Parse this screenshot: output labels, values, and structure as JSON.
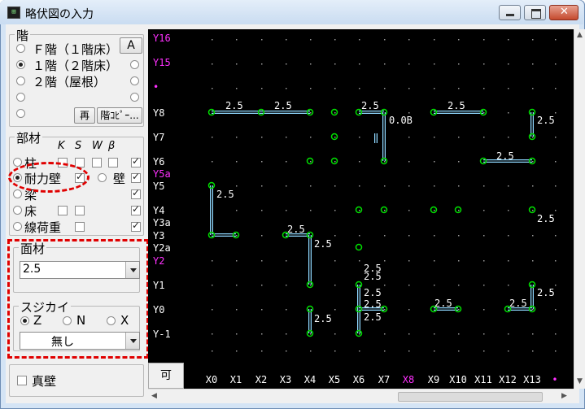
{
  "window": {
    "title": "略伏図の入力",
    "app_icon": "grid-app-icon"
  },
  "floor": {
    "title": "階",
    "a_button": "A",
    "options": [
      "Ｆ階（１階床）",
      "１階（２階床）",
      "２階（屋根）"
    ],
    "selected": 1,
    "btn_re": "再",
    "btn_copy": "階ｺﾋﾟｰ..."
  },
  "members": {
    "title": "部材",
    "headers": [
      "K",
      "S",
      "W",
      "β"
    ],
    "items": [
      {
        "label": "柱",
        "selected": false
      },
      {
        "label": "耐力壁",
        "selected": true
      },
      {
        "label": "梁",
        "selected": false
      },
      {
        "label": "床",
        "selected": false
      },
      {
        "label": "線荷重",
        "selected": false
      }
    ],
    "wall_label": "壁"
  },
  "panel_material": {
    "title": "面材",
    "value": "2.5"
  },
  "brace": {
    "title": "スジカイ",
    "options": [
      "Z",
      "N",
      "X"
    ],
    "selected": 0,
    "value": "無し"
  },
  "true_wall": {
    "label": "真壁",
    "checked": false
  },
  "canvas": {
    "corner_label": "可",
    "y_labels": [
      "Y16",
      "Y15",
      "•",
      "Y8",
      "Y7",
      "Y6",
      "Y5a",
      "Y5",
      "Y4",
      "Y3a",
      "Y3",
      "Y2a",
      "Y2",
      "Y1",
      "Y0",
      "Y-1"
    ],
    "x_labels": [
      "X0",
      "X1",
      "X2",
      "X3",
      "X4",
      "X5",
      "X6",
      "X7",
      "X8",
      "X9",
      "X10",
      "X11",
      "X12",
      "X13",
      "•"
    ],
    "wall_labels": [
      "2.5",
      "2.5",
      "2.5",
      "0.0B",
      "2.5",
      "2.5",
      "2.5",
      "2.5",
      "2.5",
      "2.5",
      "2.5",
      "2.5",
      "2.5",
      "2.5",
      "2.5",
      "2.5",
      "2.5",
      "2.5",
      "2.5",
      "2.5"
    ]
  },
  "colors": {
    "canvas_bg": "#000000",
    "wall": "#8fd8ff",
    "node": "#00e000",
    "label_white": "#ffffff",
    "label_magenta": "#ff30ff",
    "highlight_red": "#e00000"
  }
}
